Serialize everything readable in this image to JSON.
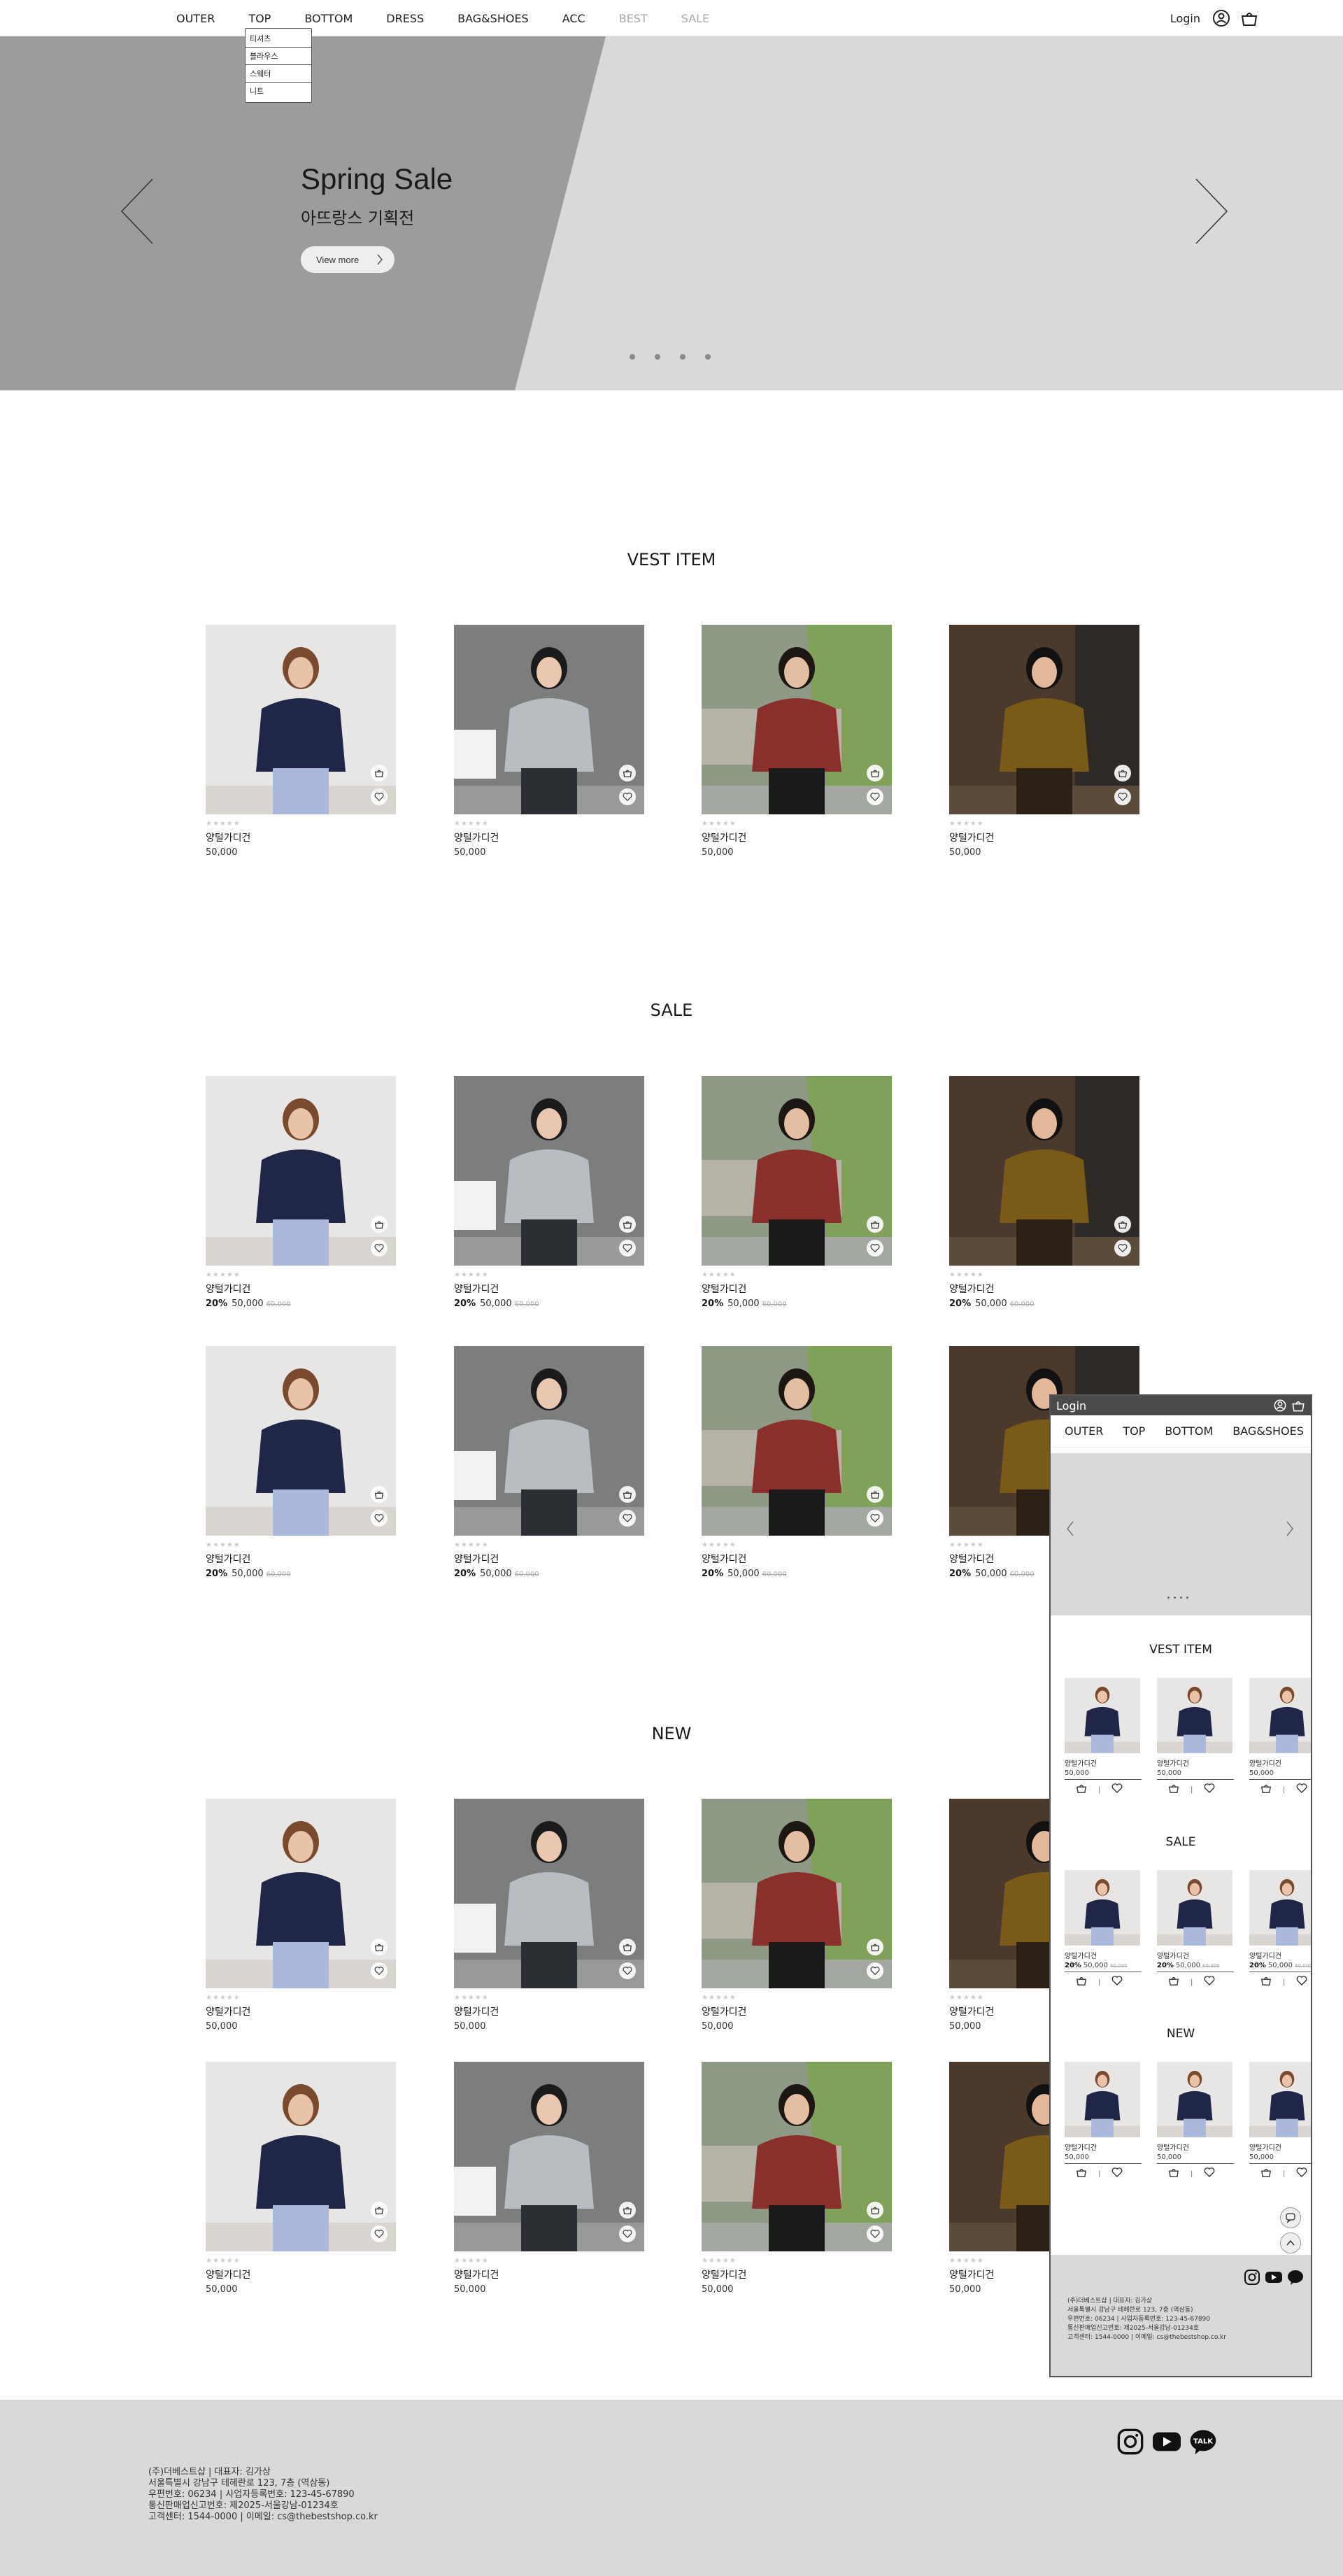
{
  "header": {
    "nav": [
      "OUTER",
      "TOP",
      "BOTTOM",
      "DRESS",
      "BAG&SHOES",
      "ACC",
      "BEST",
      "SALE"
    ],
    "login": "Login",
    "dropdown": [
      "티셔츠",
      "블라우스",
      "스웨터",
      "니트"
    ]
  },
  "hero": {
    "title": "Spring Sale",
    "subtitle": "아뜨랑스 기획전",
    "button": "View more",
    "slide_count": 4
  },
  "sections": {
    "vest": "VEST ITEM",
    "sale": "SALE",
    "new": "NEW"
  },
  "product": {
    "name": "양털가디건",
    "price": "50,000",
    "discount": "20%",
    "original_price": "60,000",
    "stars": "★★★★★"
  },
  "mobile": {
    "login": "Login",
    "nav": [
      "OUTER",
      "TOP",
      "BOTTOM",
      "BAG&SHOES"
    ],
    "vest": "VEST ITEM",
    "sale": "SALE",
    "new": "NEW",
    "footer": [
      "(주)더베스트샵 | 대표자: 김가상",
      "서울특별시 강남구 테헤란로 123, 7층 (역삼동)",
      "우편번호: 06234 | 사업자등록번호: 123-45-67890",
      "통신판매업신고번호: 제2025-서울강남-01234호",
      "고객센터: 1544-0000 | 이메일: cs@thebestshop.co.kr"
    ]
  },
  "footer": {
    "lines": [
      "(주)더베스트샵 | 대표자: 김가상",
      "서울특별시 강남구 테헤란로 123, 7층 (역삼동)",
      "우편번호: 06234 | 사업자등록번호: 123-45-67890",
      "통신판매업신고번호: 제2025-서울강남-01234호",
      "고객센터: 1544-0000 | 이메일: cs@thebestshop.co.kr"
    ],
    "talk": "TALK"
  }
}
